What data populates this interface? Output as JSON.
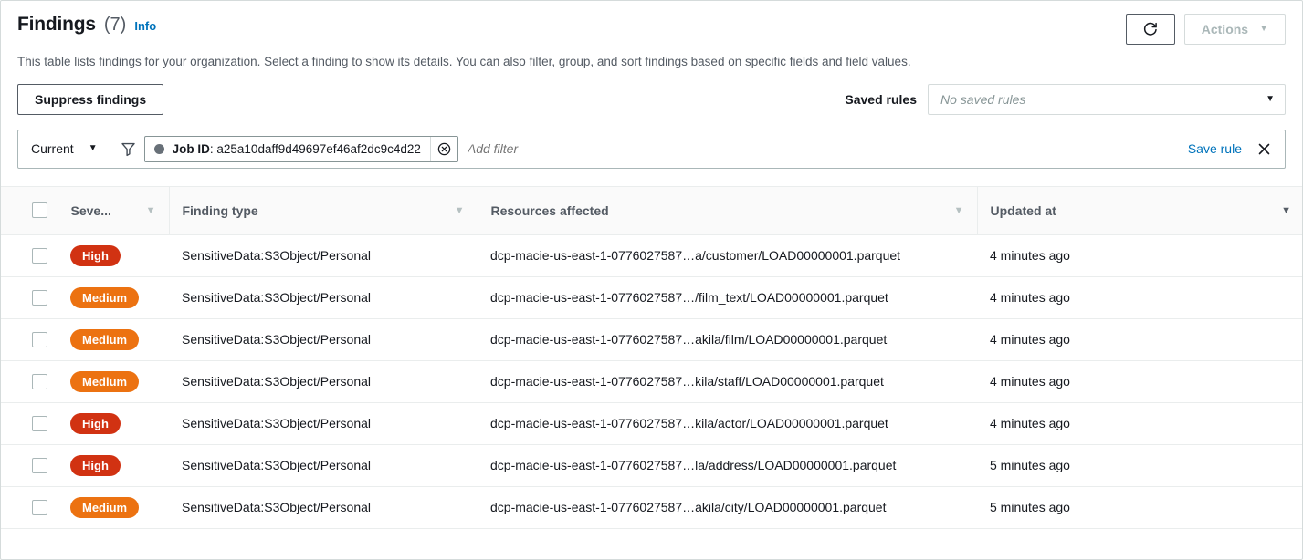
{
  "header": {
    "title": "Findings",
    "count": "(7)",
    "info_label": "Info",
    "refresh_icon": "refresh-icon",
    "actions_label": "Actions",
    "actions_caret": "▼",
    "description": "This table lists findings for your organization. Select a finding to show its details. You can also filter, group, and sort findings based on specific fields and field values."
  },
  "toolbar": {
    "suppress_label": "Suppress findings",
    "saved_rules_label": "Saved rules",
    "saved_rules_placeholder": "No saved rules",
    "saved_rules_value": "",
    "select_caret": "▼"
  },
  "filter_bar": {
    "scope_label": "Current",
    "scope_caret": "▼",
    "funnel_icon": "filter-funnel-icon",
    "token": {
      "key": "Job ID",
      "separator": ":",
      "value": "a25a10daff9d49697ef46af2dc9c4d22",
      "remove_icon": "circle-x-icon"
    },
    "add_filter_placeholder": "Add filter",
    "save_rule_label": "Save rule",
    "clear_icon": "close-x-icon"
  },
  "table": {
    "columns": [
      {
        "label": "",
        "sortable": false,
        "name": "select-all"
      },
      {
        "label": "Seve...",
        "sortable": true,
        "sort_active": false,
        "name": "severity"
      },
      {
        "label": "Finding type",
        "sortable": true,
        "sort_active": false,
        "name": "finding-type"
      },
      {
        "label": "Resources affected",
        "sortable": true,
        "sort_active": false,
        "name": "resources-affected"
      },
      {
        "label": "Updated at",
        "sortable": true,
        "sort_active": true,
        "name": "updated-at"
      }
    ],
    "sort_caret": "▼",
    "rows": [
      {
        "severity": "High",
        "severity_level": "high",
        "finding_type": "SensitiveData:S3Object/Personal",
        "resource": "dcp-macie-us-east-1-0776027587…a/customer/LOAD00000001.parquet",
        "updated_at": "4 minutes ago"
      },
      {
        "severity": "Medium",
        "severity_level": "medium",
        "finding_type": "SensitiveData:S3Object/Personal",
        "resource": "dcp-macie-us-east-1-0776027587…/film_text/LOAD00000001.parquet",
        "updated_at": "4 minutes ago"
      },
      {
        "severity": "Medium",
        "severity_level": "medium",
        "finding_type": "SensitiveData:S3Object/Personal",
        "resource": "dcp-macie-us-east-1-0776027587…akila/film/LOAD00000001.parquet",
        "updated_at": "4 minutes ago"
      },
      {
        "severity": "Medium",
        "severity_level": "medium",
        "finding_type": "SensitiveData:S3Object/Personal",
        "resource": "dcp-macie-us-east-1-0776027587…kila/staff/LOAD00000001.parquet",
        "updated_at": "4 minutes ago"
      },
      {
        "severity": "High",
        "severity_level": "high",
        "finding_type": "SensitiveData:S3Object/Personal",
        "resource": "dcp-macie-us-east-1-0776027587…kila/actor/LOAD00000001.parquet",
        "updated_at": "4 minutes ago"
      },
      {
        "severity": "High",
        "severity_level": "high",
        "finding_type": "SensitiveData:S3Object/Personal",
        "resource": "dcp-macie-us-east-1-0776027587…la/address/LOAD00000001.parquet",
        "updated_at": "5 minutes ago"
      },
      {
        "severity": "Medium",
        "severity_level": "medium",
        "finding_type": "SensitiveData:S3Object/Personal",
        "resource": "dcp-macie-us-east-1-0776027587…akila/city/LOAD00000001.parquet",
        "updated_at": "5 minutes ago"
      }
    ]
  },
  "colors": {
    "link": "#0073bb",
    "severity_high": "#d13212",
    "severity_medium": "#ec7211",
    "text": "#16191f",
    "muted": "#545b64"
  }
}
